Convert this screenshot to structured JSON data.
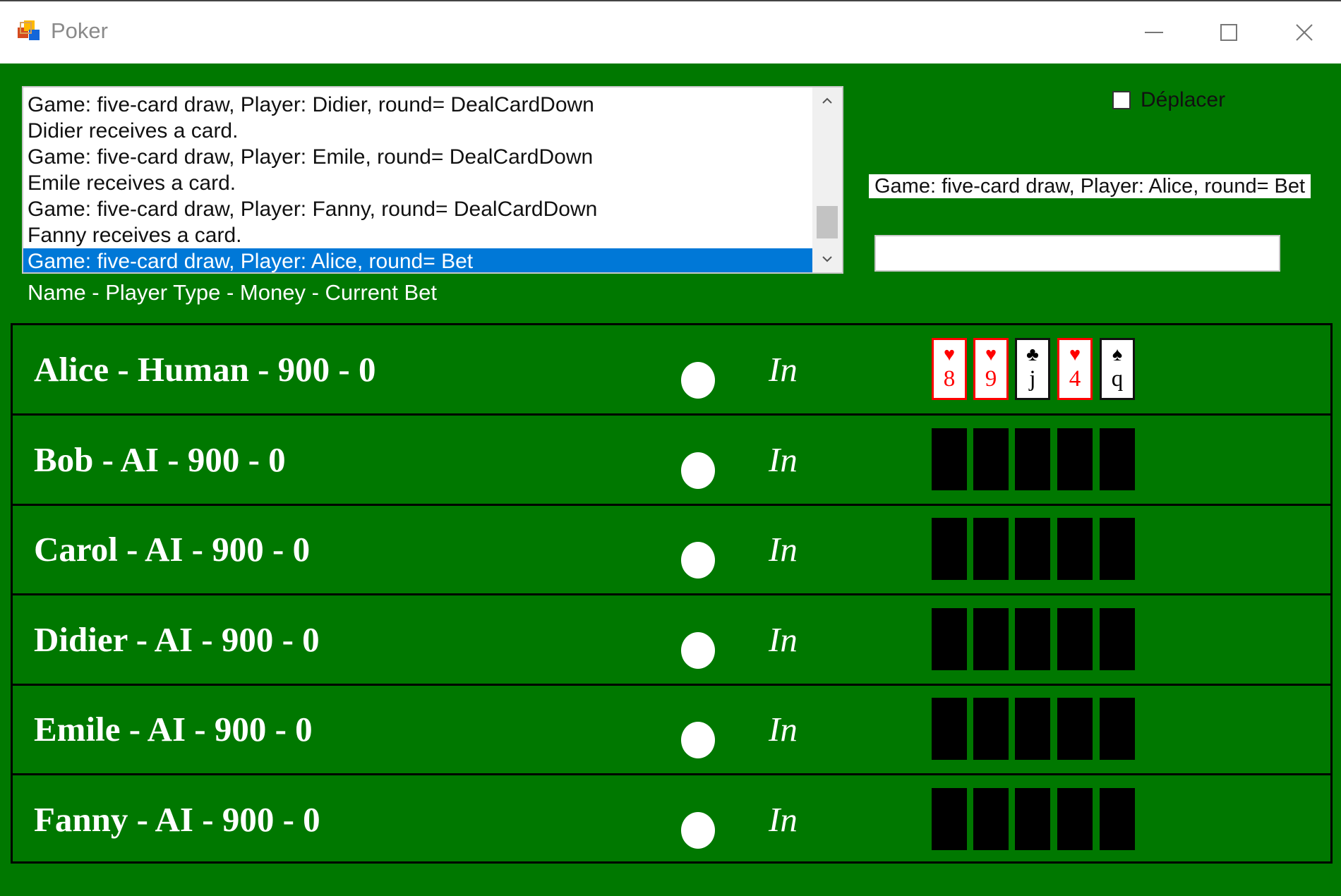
{
  "window": {
    "title": "Poker",
    "icon": "poker-app-icon",
    "colors": {
      "table_green": "#007800",
      "selection_blue": "#0078d7",
      "red_card": "#ff0000"
    }
  },
  "log": {
    "lines": [
      "Game: five-card draw, Player: Didier, round= DealCardDown",
      "Didier receives  a card.",
      "Game: five-card draw, Player: Emile, round= DealCardDown",
      "Emile receives  a card.",
      "Game: five-card draw, Player: Fanny, round= DealCardDown",
      "Fanny receives  a card.",
      "Game: five-card draw, Player: Alice, round= Bet"
    ],
    "selected_index": 6
  },
  "header": {
    "columns_label": "Name   -   Player Type   -   Money   -   Current Bet"
  },
  "controls": {
    "move_label": "Déplacer",
    "move_checked": false,
    "status": "Game: five-card draw, Player: Alice, round= Bet",
    "bet_value": ""
  },
  "players": [
    {
      "info": "Alice  -  Human  -  900  -  0",
      "status": "In",
      "cards": [
        {
          "suit": "♥",
          "rank": "8",
          "color": "red"
        },
        {
          "suit": "♥",
          "rank": "9",
          "color": "red"
        },
        {
          "suit": "♣",
          "rank": "j",
          "color": "black"
        },
        {
          "suit": "♥",
          "rank": "4",
          "color": "red"
        },
        {
          "suit": "♠",
          "rank": "q",
          "color": "black"
        }
      ]
    },
    {
      "info": "Bob  -  AI  -  900  -  0",
      "status": "In",
      "cards": [
        {
          "hidden": true
        },
        {
          "hidden": true
        },
        {
          "hidden": true
        },
        {
          "hidden": true
        },
        {
          "hidden": true
        }
      ]
    },
    {
      "info": "Carol  -  AI  -  900  -  0",
      "status": "In",
      "cards": [
        {
          "hidden": true
        },
        {
          "hidden": true
        },
        {
          "hidden": true
        },
        {
          "hidden": true
        },
        {
          "hidden": true
        }
      ]
    },
    {
      "info": "Didier  -  AI  -  900  -  0",
      "status": "In",
      "cards": [
        {
          "hidden": true
        },
        {
          "hidden": true
        },
        {
          "hidden": true
        },
        {
          "hidden": true
        },
        {
          "hidden": true
        }
      ]
    },
    {
      "info": "Emile  -  AI  -  900  -  0",
      "status": "In",
      "cards": [
        {
          "hidden": true
        },
        {
          "hidden": true
        },
        {
          "hidden": true
        },
        {
          "hidden": true
        },
        {
          "hidden": true
        }
      ]
    },
    {
      "info": "Fanny  -  AI  -  900  -  0",
      "status": "In",
      "cards": [
        {
          "hidden": true
        },
        {
          "hidden": true
        },
        {
          "hidden": true
        },
        {
          "hidden": true
        },
        {
          "hidden": true
        }
      ]
    }
  ]
}
